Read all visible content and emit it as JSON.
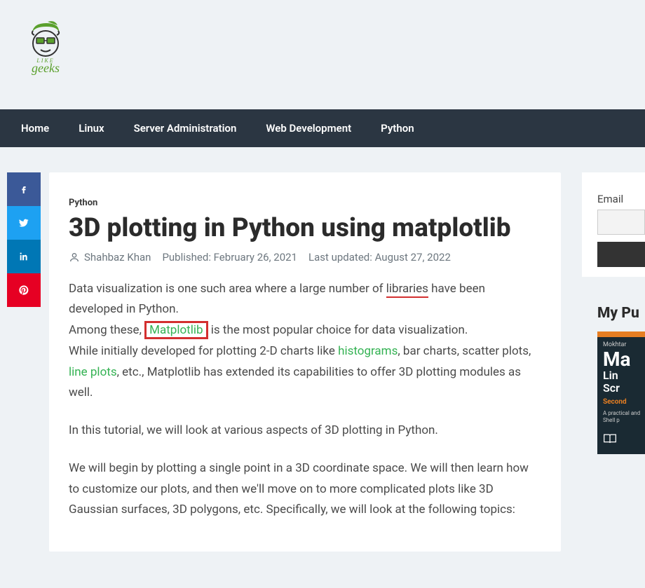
{
  "nav": {
    "items": [
      "Home",
      "Linux",
      "Server Administration",
      "Web Development",
      "Python"
    ]
  },
  "article": {
    "category": "Python",
    "title": "3D plotting in Python using matplotlib",
    "author": "Shahbaz Khan",
    "published_label": "Published: February 26, 2021",
    "updated_label": "Last updated: August 27, 2022",
    "p1_a": "Data visualization is one such area where a large number of ",
    "p1_lib": "libraries",
    "p1_b": " have been developed in Python.",
    "p2_a": "Among these, ",
    "p2_link": "Matplotlib",
    "p2_b": " is the most popular choice for data visualization.",
    "p3_a": "While initially developed for plotting 2-D charts like ",
    "p3_hist": "histograms",
    "p3_b": ", bar charts, scatter plots, ",
    "p3_line": "line plots",
    "p3_c": ", etc., Matplotlib has extended its capabilities to offer 3D plotting modules as well.",
    "p4": "In this tutorial, we will look at various aspects of 3D plotting in Python.",
    "p5": "We will begin by plotting a single point in a 3D coordinate space. We will then learn how to customize our plots, and then we'll move on to more complicated plots like 3D Gaussian surfaces, 3D polygons, etc. Specifically, we will look at the following topics:"
  },
  "sidebar": {
    "email_label": "Email",
    "section_title": "My Pu",
    "book": {
      "author": "Mokhtar",
      "big": "Ma",
      "sub1": "Lin",
      "sub2": "Scr",
      "edition": "Second",
      "desc": "A practical and Shell p"
    }
  }
}
